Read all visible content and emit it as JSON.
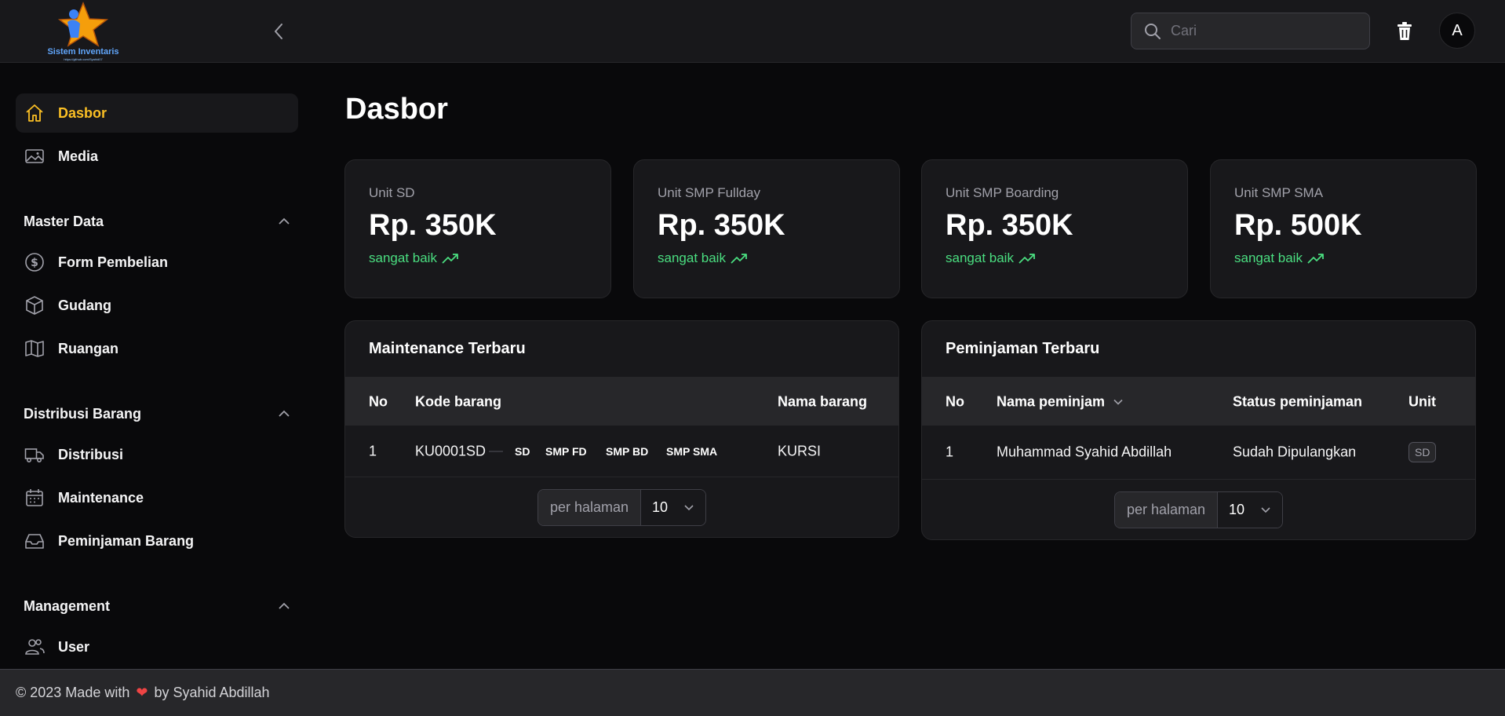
{
  "app": {
    "logo_text": "Sistem Inventaris",
    "logo_subtext": "https://github.com/Syahid07"
  },
  "header": {
    "search_placeholder": "Cari",
    "avatar_initial": "A"
  },
  "sidebar": {
    "top_items": [
      {
        "label": "Dasbor",
        "icon": "home-icon",
        "active": true
      },
      {
        "label": "Media",
        "icon": "image-icon",
        "active": false
      }
    ],
    "groups": [
      {
        "title": "Master Data",
        "items": [
          {
            "label": "Form Pembelian",
            "icon": "dollar-circle-icon"
          },
          {
            "label": "Gudang",
            "icon": "cube-icon"
          },
          {
            "label": "Ruangan",
            "icon": "map-icon"
          }
        ]
      },
      {
        "title": "Distribusi Barang",
        "items": [
          {
            "label": "Distribusi",
            "icon": "truck-icon"
          },
          {
            "label": "Maintenance",
            "icon": "calendar-icon"
          },
          {
            "label": "Peminjaman Barang",
            "icon": "inbox-icon"
          }
        ]
      },
      {
        "title": "Management",
        "items": [
          {
            "label": "User",
            "icon": "users-icon"
          }
        ]
      }
    ]
  },
  "page": {
    "title": "Dasbor"
  },
  "stats": [
    {
      "label": "Unit SD",
      "value": "Rp. 350K",
      "desc": "sangat baik"
    },
    {
      "label": "Unit SMP Fullday",
      "value": "Rp. 350K",
      "desc": "sangat baik"
    },
    {
      "label": "Unit SMP Boarding",
      "value": "Rp. 350K",
      "desc": "sangat baik"
    },
    {
      "label": "Unit SMP SMA",
      "value": "Rp. 500K",
      "desc": "sangat baik"
    }
  ],
  "maintenance": {
    "title": "Maintenance Terbaru",
    "columns": [
      "No",
      "Kode barang",
      "Nama barang"
    ],
    "rows": [
      {
        "no": "1",
        "kode": "KU0001SD",
        "tags": [
          "SD",
          "SMP FD",
          "SMP BD",
          "SMP SMA"
        ],
        "nama": "KURSI"
      }
    ],
    "per_page_label": "per halaman",
    "per_page_value": "10"
  },
  "peminjaman": {
    "title": "Peminjaman Terbaru",
    "columns": [
      "No",
      "Nama peminjam",
      "Status peminjaman",
      "Unit"
    ],
    "rows": [
      {
        "no": "1",
        "nama": "Muhammad Syahid Abdillah",
        "status": "Sudah Dipulangkan",
        "unit": "SD"
      }
    ],
    "per_page_label": "per halaman",
    "per_page_value": "10"
  },
  "footer": {
    "prefix": "© 2023 Made with",
    "suffix": "by Syahid Abdillah"
  },
  "colors": {
    "accent": "#fbbf24",
    "positive": "#4ade80",
    "background": "#09090b",
    "surface": "#18181b",
    "heart": "#ef4444"
  }
}
